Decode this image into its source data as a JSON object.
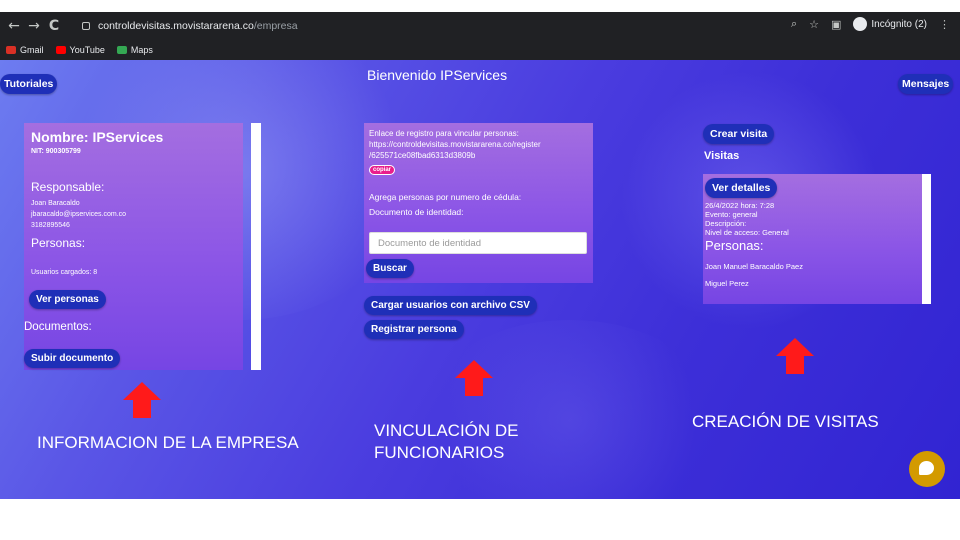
{
  "browser": {
    "back": "←",
    "forward": "→",
    "reload": "C",
    "url_host": "controldevisitas.movistararena.co",
    "url_path": "/empresa",
    "incognito_label": "Incógnito (2)",
    "bookmarks": [
      {
        "label": "Gmail",
        "color": "#d93025"
      },
      {
        "label": "YouTube",
        "color": "#ff0000"
      },
      {
        "label": "Maps",
        "color": "#34a853"
      }
    ]
  },
  "header": {
    "tutorials": "Tutoriales",
    "welcome": "Bienvenido IPServices",
    "messages": "Mensajes"
  },
  "company": {
    "name": "Nombre: IPServices",
    "nit": "NIT: 900305799",
    "responsible_label": "Responsable:",
    "responsible_name": "Joan Baracaldo",
    "responsible_email": "jbaracaldo@ipservices.com.co",
    "responsible_phone": "3182895546",
    "people_label": "Personas:",
    "users_loaded": "Usuarios cargados: 8",
    "view_people": "Ver personas",
    "documents_label": "Documentos:",
    "upload_doc": "Subir documento"
  },
  "linking": {
    "link_intro": "Enlace de registro para vincular personas:",
    "link_line1": "https://controldevisitas.movistararena.co/register",
    "link_line2": "/625571ce08fbad6313d3809b",
    "copy": "copiar",
    "add_by_id": "Agrega personas por numero de cédula:",
    "id_label": "Documento de identidad:",
    "id_placeholder": "Documento de identidad",
    "search": "Buscar",
    "csv_upload": "Cargar usuarios con archivo CSV",
    "register_person": "Registrar persona"
  },
  "visits": {
    "create_visit": "Crear visita",
    "visits_label": "Visitas",
    "details": "Ver detalles",
    "date_time": "26/4/2022 hora: 7:28",
    "event": "Evento: general",
    "description": "Descripción:",
    "access": "Nivel de acceso: General",
    "people_label": "Personas:",
    "people": [
      "Joan Manuel Baracaldo Paez",
      "Miguel Perez"
    ]
  },
  "captions": {
    "company_info": "INFORMACION DE LA EMPRESA",
    "linking_line1": "VINCULACIÓN DE",
    "linking_line2": "FUNCIONARIOS",
    "visits_creation": "CREACIÓN DE VISITAS"
  },
  "colors": {
    "accent_button": "#1f2fb8",
    "arrow": "#ff1a1a",
    "chat": "#d39a00",
    "copy_badge": "#e91e8c"
  }
}
